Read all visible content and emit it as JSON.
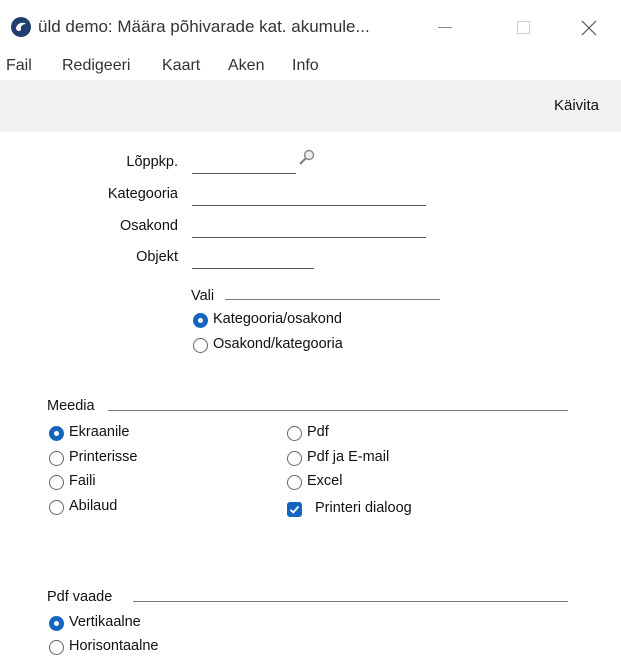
{
  "window": {
    "title": "üld demo: Määra põhivarade kat. akumule..."
  },
  "menu": [
    "Fail",
    "Redigeeri",
    "Kaart",
    "Aken",
    "Info"
  ],
  "toolbar": {
    "run_label": "Käivita"
  },
  "form": {
    "end_date": {
      "label": "Lõppkp.",
      "value": ""
    },
    "category": {
      "label": "Kategooria",
      "value": ""
    },
    "department": {
      "label": "Osakond",
      "value": ""
    },
    "object": {
      "label": "Objekt",
      "value": ""
    }
  },
  "vali": {
    "title": "Vali",
    "options": [
      "Kategooria/osakond",
      "Osakond/kategooria"
    ],
    "selected": 0
  },
  "meedia": {
    "title": "Meedia",
    "left_options": [
      "Ekraanile",
      "Printerisse",
      "Faili",
      "Abilaud"
    ],
    "right_options": [
      "Pdf",
      "Pdf ja E-mail",
      "Excel"
    ],
    "selected": "Ekraanile",
    "printer_dialog": {
      "label": "Printeri dialoog",
      "checked": true
    }
  },
  "pdf_vaade": {
    "title": "Pdf vaade",
    "options": [
      "Vertikaalne",
      "Horisontaalne"
    ],
    "selected": 0
  },
  "colors": {
    "accent": "#1565c0",
    "toolbar_bg": "#f1f1f1"
  },
  "icons": {
    "app": "app-icon",
    "search": "search-icon"
  }
}
